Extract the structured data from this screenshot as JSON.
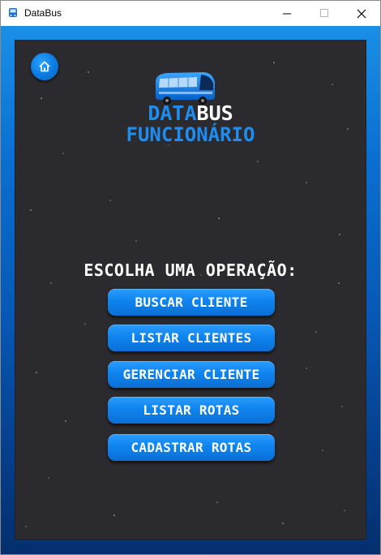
{
  "window": {
    "title": "DataBus",
    "controls": [
      "minimize",
      "maximize",
      "close"
    ]
  },
  "header": {
    "home_icon": "home-icon",
    "logo_icon": "bus-icon",
    "logo_word1": "DATA",
    "logo_word2": "BUS",
    "logo_subtitle": "FUNCIONÁRIO"
  },
  "main": {
    "heading": "ESCOLHA UMA OPERAÇÃO:",
    "buttons": [
      {
        "label": "BUSCAR CLIENTE"
      },
      {
        "label": "LISTAR CLIENTES"
      },
      {
        "label": "GERENCIAR CLIENTE"
      },
      {
        "label": "LISTAR ROTAS"
      },
      {
        "label": "CADASTRAR ROTAS"
      }
    ]
  },
  "colors": {
    "accent": "#1f8cf0",
    "panel": "#2b2b2f",
    "button": "#0f84ee"
  }
}
